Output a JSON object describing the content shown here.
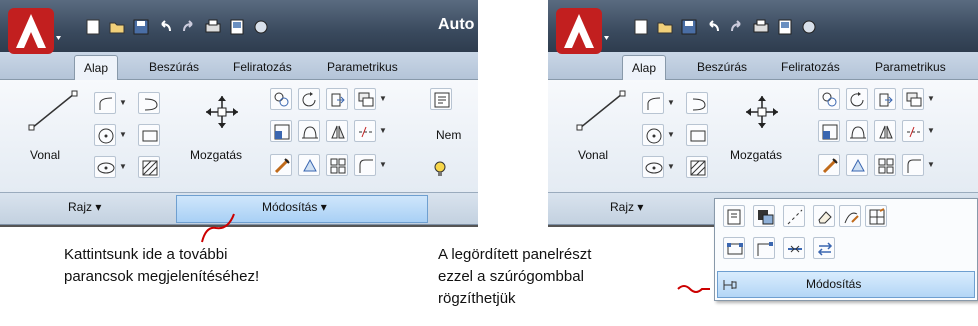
{
  "colors": {
    "accent": "#b3d6f6",
    "logo_red": "#c21f1f",
    "annotation_red": "#cc0000"
  },
  "left_screen": {
    "title": "Auto",
    "tabs": [
      "Alap",
      "Beszúrás",
      "Feliratozás",
      "Parametrikus"
    ],
    "active_tab": "Alap",
    "big_tools": {
      "line": "Vonal",
      "move": "Mozgatás"
    },
    "text_tool": "Nem",
    "panels": {
      "draw": "Rajz",
      "modify": "Módosítás"
    }
  },
  "right_screen": {
    "tabs": [
      "Alap",
      "Beszúrás",
      "Feliratozás",
      "Parametrikus"
    ],
    "active_tab": "Alap",
    "big_tools": {
      "line": "Vonal",
      "move": "Mozgatás"
    },
    "panels": {
      "draw": "Rajz"
    },
    "flyout_title": "Módosítás"
  },
  "annotations": {
    "left_line1": "Kattintsunk ide a  további",
    "left_line2": "parancsok megjelenítéséhez!",
    "right_line1": "A legördített panelrészt",
    "right_line2": "ezzel a szúrógombbal",
    "right_line3": "rögzíthetjük"
  },
  "icons": [
    "autocad-logo-icon",
    "new-icon",
    "open-icon",
    "save-icon",
    "undo-icon",
    "redo-icon",
    "print-icon",
    "plot-icon",
    "publish-icon",
    "line-icon",
    "polyline-icon",
    "circle-icon",
    "arc-icon",
    "rectangle-icon",
    "ellipse-icon",
    "hatch-icon",
    "move-icon",
    "copy-icon",
    "rotate-icon",
    "trim-icon",
    "mirror-icon",
    "fillet-icon",
    "stretch-icon",
    "scale-icon",
    "array-icon",
    "erase-icon",
    "explode-icon",
    "offset-icon",
    "pushpin-icon"
  ]
}
